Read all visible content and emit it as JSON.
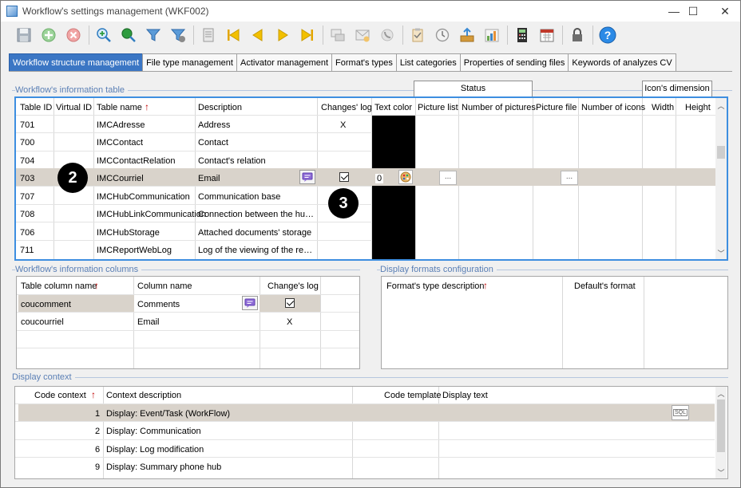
{
  "window": {
    "title": "Workflow's settings management (WKF002)",
    "minimize": "—",
    "maximize": "☐",
    "close": "✕"
  },
  "toolbar": {
    "icons": [
      "save-icon",
      "add-icon",
      "delete-icon",
      "zoom-add-icon",
      "zoom-search-icon",
      "filter-icon",
      "filter-settings-icon",
      "script-icon",
      "first-icon",
      "previous-icon",
      "next-icon",
      "last-icon",
      "comment-icon",
      "email-icon",
      "phone-icon",
      "clipboard-icon",
      "history-icon",
      "export-icon",
      "chart-icon",
      "calculator-icon",
      "calendar-icon",
      "lock-icon",
      "help-icon"
    ]
  },
  "tabs": [
    "Workflow structure management",
    "File type management",
    "Activator management",
    "Format's types",
    "List categories",
    "Properties of sending files",
    "Keywords of analyzes CV"
  ],
  "info_table": {
    "group_title": "Workflow's information table",
    "status_header": "Status",
    "icon_dim_header": "Icon's dimension",
    "columns": [
      "Table ID",
      "Virtual ID",
      "Table name",
      "Description",
      "Changes' log",
      "Text color",
      "Picture list",
      "Number of pictures",
      "Picture file",
      "Number of icons",
      "Width",
      "Height"
    ],
    "rows": [
      {
        "id": "701",
        "name": "IMCAdresse",
        "desc": "Address",
        "log": "X",
        "color": ""
      },
      {
        "id": "700",
        "name": "IMCContact",
        "desc": "Contact",
        "log": "",
        "color": ""
      },
      {
        "id": "704",
        "name": "IMCContactRelation",
        "desc": "Contact's relation",
        "log": "",
        "color": ""
      },
      {
        "id": "703",
        "name": "IMCCourriel",
        "desc": "Email",
        "log": "checked",
        "color": "0"
      },
      {
        "id": "707",
        "name": "IMCHubCommunication",
        "desc": "Communication base",
        "log": "",
        "color": ""
      },
      {
        "id": "708",
        "name": "IMCHubLinkCommunication",
        "desc": "Connection between the hub ...",
        "log": "",
        "color": ""
      },
      {
        "id": "706",
        "name": "IMCHubStorage",
        "desc": "Attached documents' storage",
        "log": "",
        "color": ""
      },
      {
        "id": "711",
        "name": "IMCReportWebLog",
        "desc": "Log of the viewing of the repo...",
        "log": "",
        "color": ""
      }
    ],
    "dots": "...",
    "badge2": "2",
    "badge3": "3"
  },
  "info_columns": {
    "group_title": "Workflow's information columns",
    "columns": [
      "Table column name",
      "Column name",
      "Change's log"
    ],
    "rows": [
      {
        "table_col": "coucomment",
        "col": "Comments",
        "log": "checked"
      },
      {
        "table_col": "coucourriel",
        "col": "Email",
        "log": "X"
      }
    ]
  },
  "formats": {
    "group_title": "Display formats configuration",
    "columns": [
      "Format's type description",
      "Default's format"
    ]
  },
  "context": {
    "group_title": "Display context",
    "columns": [
      "Code context",
      "Context description",
      "Code template",
      "Display text"
    ],
    "rows": [
      {
        "code": "1",
        "desc": "Display: Event/Task (WorkFlow)"
      },
      {
        "code": "2",
        "desc": "Display: Communication"
      },
      {
        "code": "6",
        "desc": "Display: Log modification"
      },
      {
        "code": "9",
        "desc": "Display: Summary phone hub"
      }
    ],
    "sql_label": "SQL"
  },
  "colors": {
    "accent": "#3b76c4",
    "selected_row": "#d9d3cb",
    "group_title": "#5a7fb5",
    "focus_border": "#3d8ee0"
  }
}
